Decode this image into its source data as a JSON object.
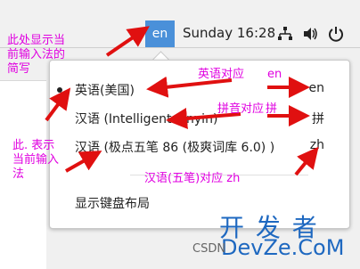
{
  "topbar": {
    "language_indicator": "en",
    "clock": "Sunday 16:28",
    "tray_icons": [
      "network-icon",
      "volume-icon",
      "power-icon"
    ]
  },
  "input_menu": {
    "items": [
      {
        "label": "英语(美国)",
        "code": "en",
        "selected": true
      },
      {
        "label": "汉语 (Intelligent Pinyin)",
        "code": "拼",
        "selected": false
      },
      {
        "label": "汉语 (极点五笔 86 (极爽词库 6.0) )",
        "code": "zh",
        "selected": false
      }
    ],
    "show_layout_label": "显示键盘布局"
  },
  "annotations": {
    "top_left": "此处显示当\n前输入法的\n简写",
    "left_mid": "此. 表示\n当前输入\n法",
    "english_map": "英语对应",
    "english_code": "en",
    "pinyin_map": "拼音对应",
    "pinyin_code": "拼",
    "wubi_map": "汉语(五笔)对应 zh"
  },
  "watermark": {
    "line1": "开 发 者",
    "line2": "DevZe.CoM",
    "csdn": "CSDN"
  },
  "colors": {
    "accent": "#4a90d9",
    "annotation": "#e000e0",
    "arrow": "#e01010",
    "watermark": "#1e68c0"
  }
}
